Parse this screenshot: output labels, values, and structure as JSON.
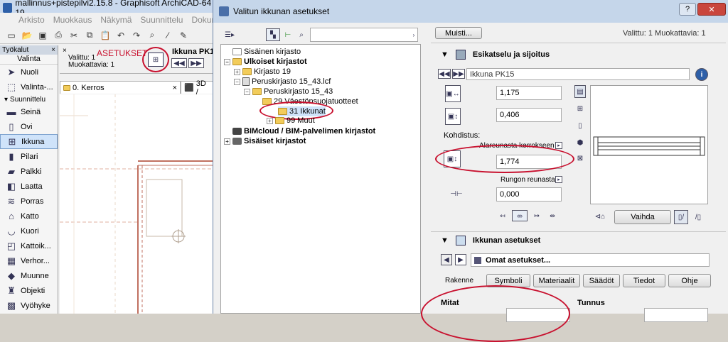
{
  "app": {
    "title": "mallinnus+pistepilvi2.15.8 - Graphisoft ArchiCAD-64 19",
    "menu": [
      "Arkisto",
      "Muokkaus",
      "Näkymä",
      "Suunnittelu",
      "Dokument"
    ]
  },
  "toolbox": {
    "header": "Työkalut",
    "select_section": "Valinta",
    "tools_top": [
      {
        "label": "Nuoli",
        "icon": "arrow-icon"
      },
      {
        "label": "Valinta-...",
        "icon": "marquee-icon"
      }
    ],
    "design_section": "Suunnittelu",
    "tools": [
      {
        "label": "Seinä",
        "icon": "wall-icon"
      },
      {
        "label": "Ovi",
        "icon": "door-icon"
      },
      {
        "label": "Ikkuna",
        "icon": "window-icon",
        "selected": true
      },
      {
        "label": "Pilari",
        "icon": "column-icon"
      },
      {
        "label": "Palkki",
        "icon": "beam-icon"
      },
      {
        "label": "Laatta",
        "icon": "slab-icon"
      },
      {
        "label": "Porras",
        "icon": "stair-icon"
      },
      {
        "label": "Katto",
        "icon": "roof-icon"
      },
      {
        "label": "Kuori",
        "icon": "shell-icon"
      },
      {
        "label": "Kattoik...",
        "icon": "skylight-icon"
      },
      {
        "label": "Verhor...",
        "icon": "curtain-wall-icon"
      },
      {
        "label": "Muunne",
        "icon": "morph-icon"
      },
      {
        "label": "Objekti",
        "icon": "object-icon"
      },
      {
        "label": "Vyöhyke",
        "icon": "zone-icon"
      }
    ]
  },
  "infobox": {
    "selected": "Valittu: 1",
    "editable": "Muokattavia: 1",
    "annotation": "ASETUKSET",
    "element": "Ikkuna PK1"
  },
  "tabs": [
    {
      "label": "0. Kerros"
    },
    {
      "label": "3D /"
    }
  ],
  "dialog": {
    "title": "Valitun ikkunan asetukset",
    "help_button": "?",
    "close_button": "✕",
    "status": "Valittu: 1 Muokattavia: 1",
    "memo_button": "Muisti...",
    "tree": [
      {
        "label": "Sisäinen kirjasto",
        "bold": false
      },
      {
        "label": "Ulkoiset kirjastot",
        "bold": true
      },
      {
        "label": "Kirjasto 19",
        "bold": false
      },
      {
        "label": "Peruskirjasto 15_43.lcf",
        "bold": false
      },
      {
        "label": "Peruskirjasto 15_43",
        "bold": false
      },
      {
        "label": "29 Väestönsuojatuotteet",
        "bold": false
      },
      {
        "label": "31 Ikkunat",
        "bold": false
      },
      {
        "label": "99 Muut",
        "bold": false
      },
      {
        "label": "BIMcloud / BIM-palvelimen kirjastot",
        "bold": true
      },
      {
        "label": "Sisäiset kirjastot",
        "bold": true
      }
    ],
    "preview": {
      "header": "Esikatselu ja sijoitus",
      "name": "Ikkuna PK15",
      "width": "1,175",
      "height": "0,406",
      "anchor_label": "Kohdistus:",
      "anchor_ref": "Alareunasta kerrokseen 0",
      "sill": "1,774",
      "frame_ref": "Rungon reunasta",
      "offset": "0,000",
      "swap_button": "Vaihda"
    },
    "window_settings": {
      "header": "Ikkunan asetukset",
      "preset": "Omat asetukset...",
      "structure_label": "Rakenne",
      "tabs": [
        "Symboli",
        "Materiaalit",
        "Säädöt",
        "Tiedot",
        "Ohje"
      ],
      "dimensions_label": "Mitat",
      "id_label": "Tunnus"
    },
    "annotation_color": "#c8102e"
  }
}
